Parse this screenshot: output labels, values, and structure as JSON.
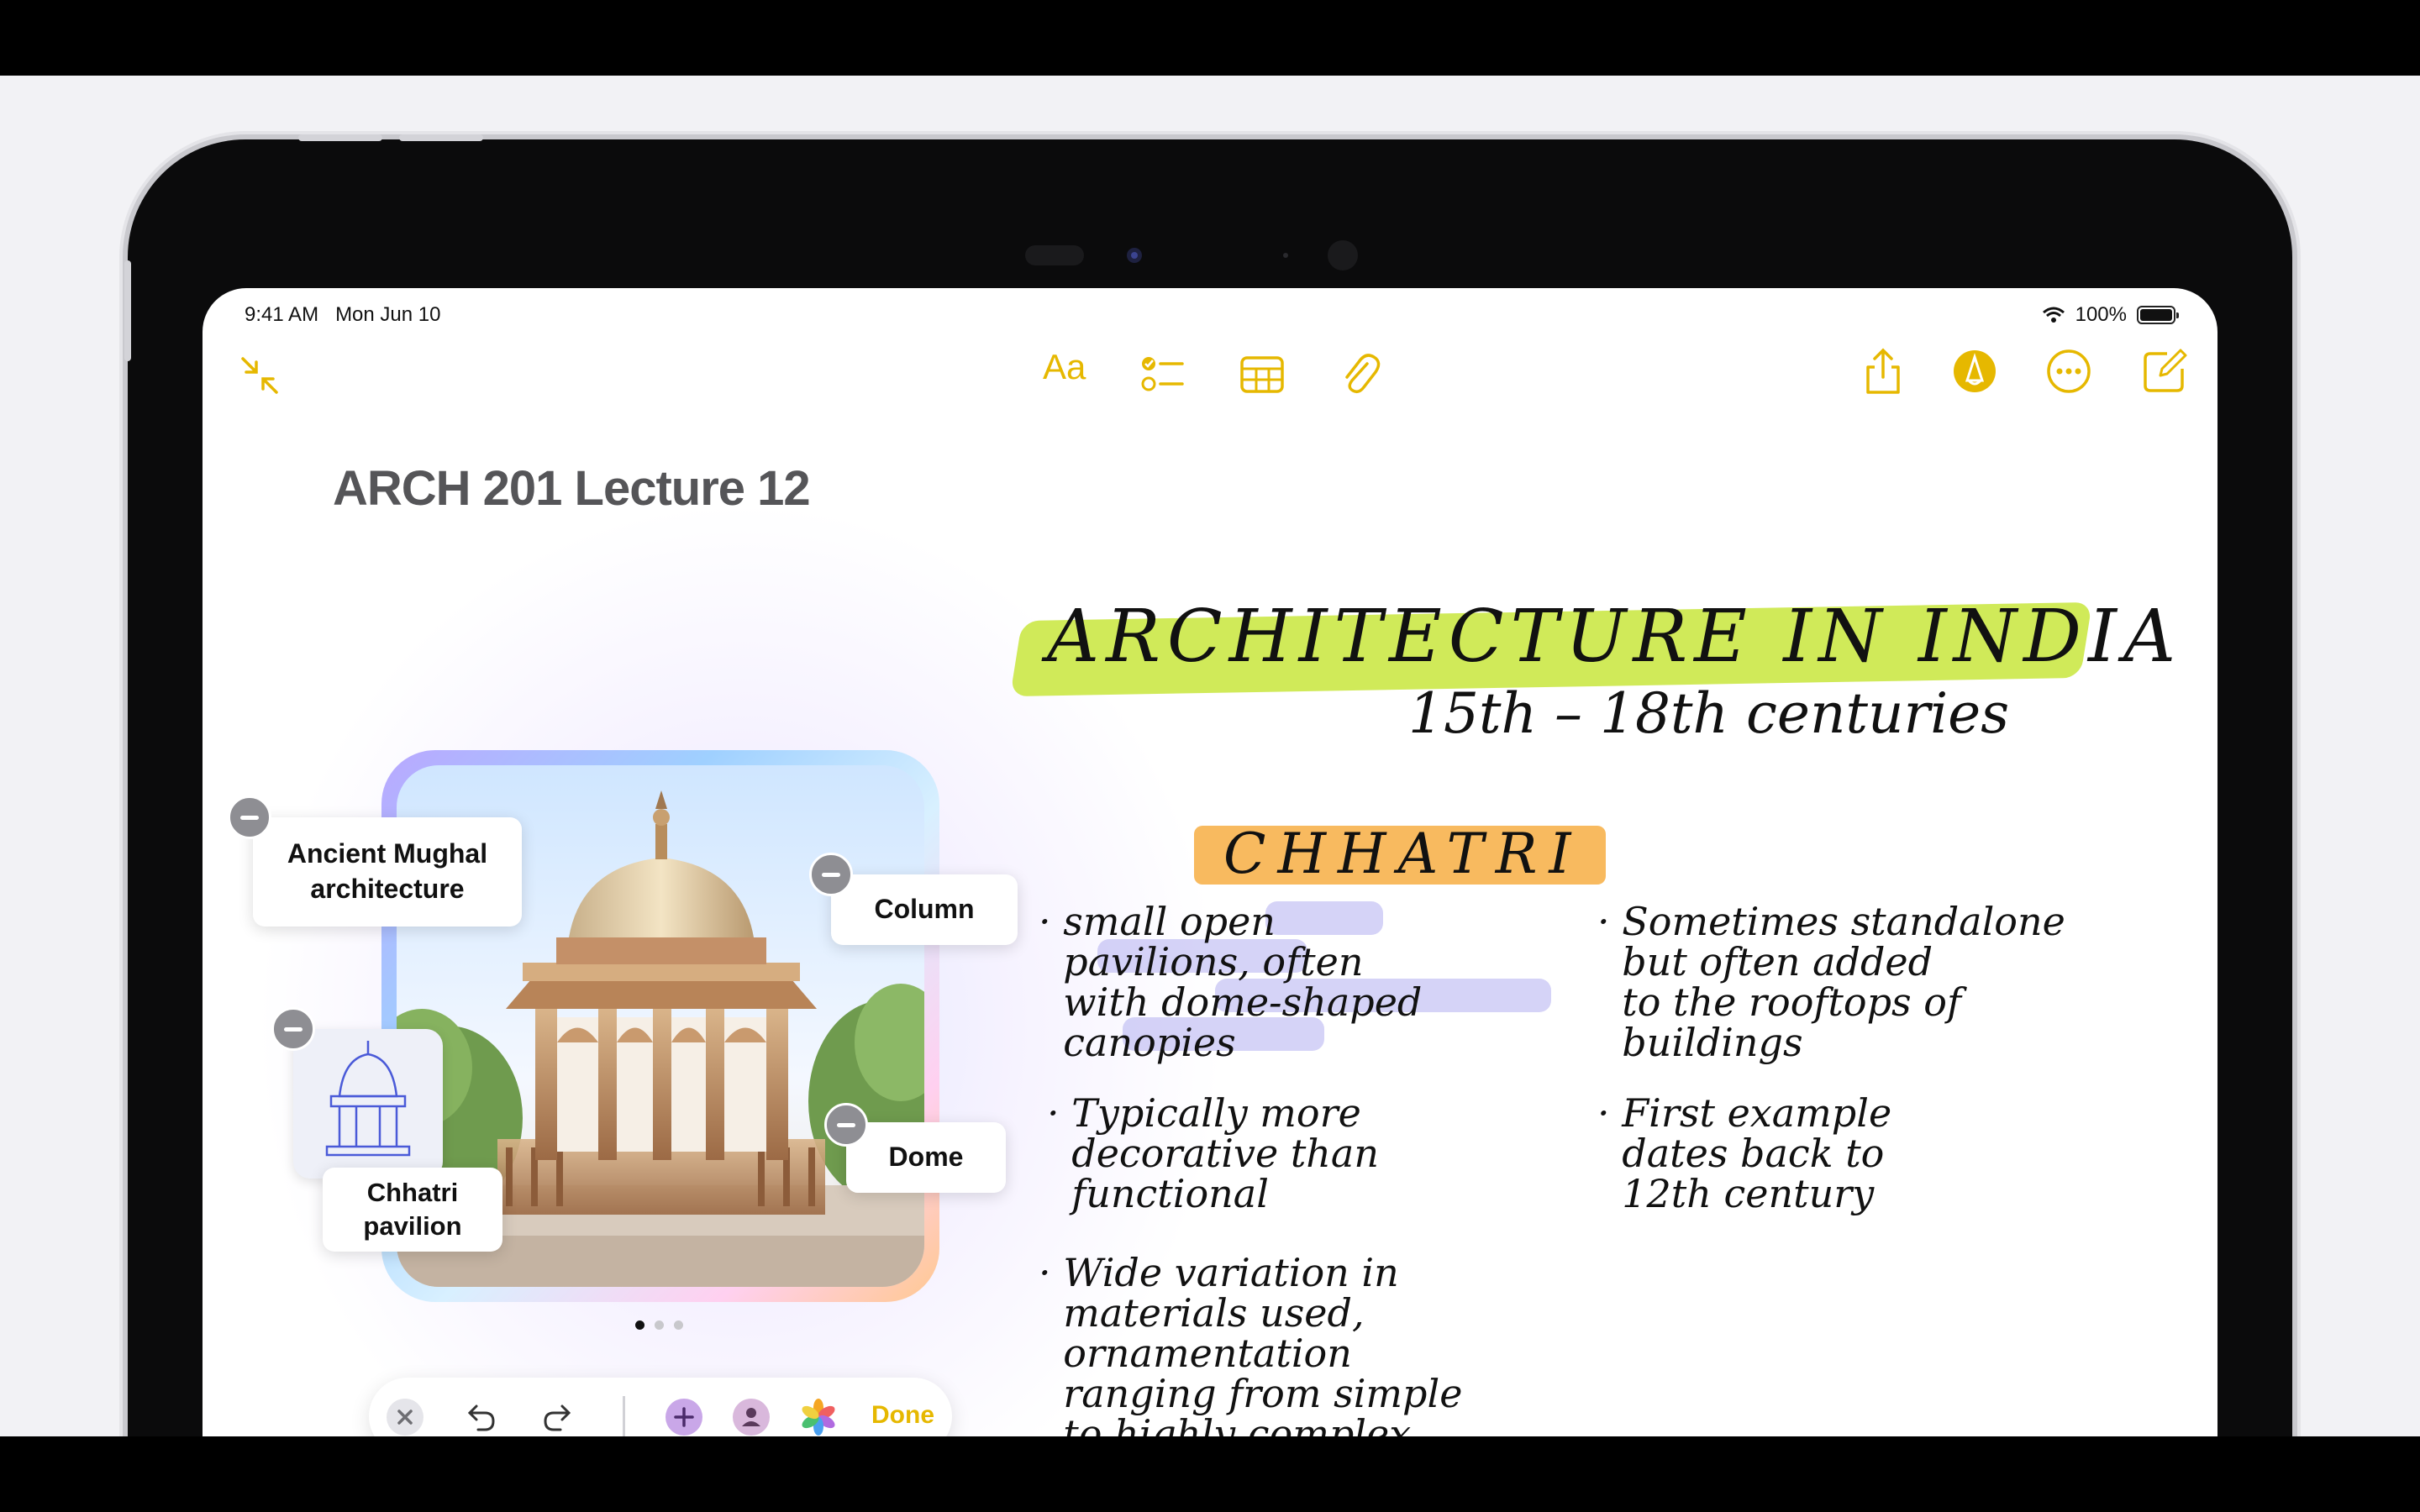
{
  "status_bar": {
    "time": "9:41 AM",
    "date": "Mon Jun 10",
    "battery": "100%",
    "battery_level": 1.0
  },
  "toolbar": {
    "format_label": "Aa",
    "icons": [
      "collapse-icon",
      "checklist-icon",
      "table-icon",
      "paperclip-icon",
      "share-icon",
      "markup-pen-icon",
      "more-icon",
      "compose-icon"
    ],
    "accent_color": "#e6b800"
  },
  "note": {
    "title": "ARCH 201 Lecture 12"
  },
  "image_labels": {
    "ancient": "Ancient Mughal\narchitecture",
    "column": "Column",
    "dome": "Dome",
    "pavilion": "Chhatri\npavilion"
  },
  "carousel": {
    "pages": 3,
    "current": 1
  },
  "edit_bar": {
    "done_label": "Done"
  },
  "handwriting": {
    "heading": "ARCHITECTURE IN INDIA",
    "subheading": "15th – 18th centuries",
    "section": "CHHATRI",
    "bullets": [
      "small open\npavilions, often\nwith dome-shaped\ncanopies",
      "Sometimes standalone\nbut often added\nto the rooftops of\nbuildings",
      "Typically more\ndecorative than\nfunctional",
      "First example\ndates back to\n12th century",
      "Wide variation in\nmaterials used,\nornamentation\nranging from simple\nto highly complex"
    ]
  },
  "colors": {
    "highlight_green": "#c8e63c",
    "highlight_orange": "#f7b24e",
    "highlight_purple": "#b9b6f2"
  }
}
